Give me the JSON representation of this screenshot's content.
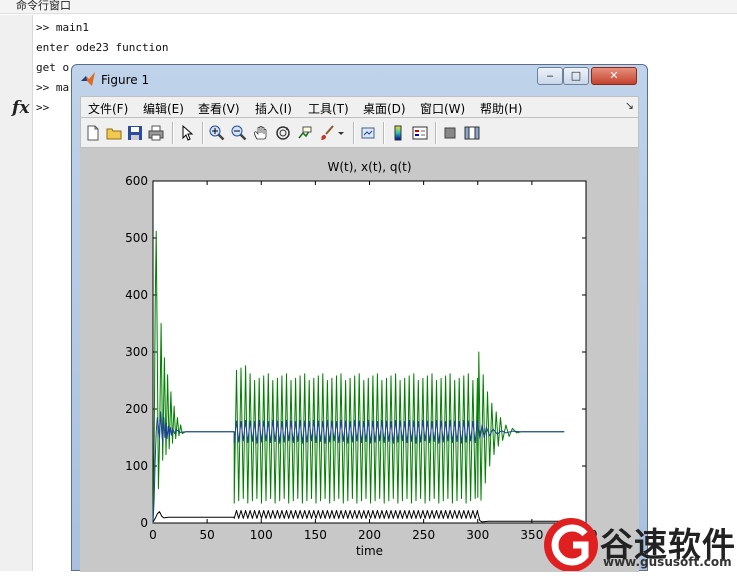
{
  "command_window": {
    "title": "命令行窗口",
    "lines": [
      ">> main1",
      "enter ode23 function",
      "get o",
      ">> ma",
      ">>"
    ],
    "fx_label": "fx"
  },
  "figure": {
    "title": "Figure 1",
    "menu": [
      "文件(F)",
      "编辑(E)",
      "查看(V)",
      "插入(I)",
      "工具(T)",
      "桌面(D)",
      "窗口(W)",
      "帮助(H)"
    ],
    "toolbar_icons": [
      "new-figure-icon",
      "open-file-icon",
      "save-icon",
      "print-icon",
      "pointer-icon",
      "zoom-in-icon",
      "zoom-out-icon",
      "pan-hand-icon",
      "rotate-3d-icon",
      "data-cursor-icon",
      "brush-icon",
      "link-plot-icon",
      "colorbar-icon",
      "legend-icon",
      "hide-plot-tools-icon",
      "show-plot-tools-icon"
    ]
  },
  "chart_data": {
    "type": "line",
    "title": "W(t), x(t), q(t)",
    "xlabel": "time",
    "ylabel": "",
    "xlim": [
      0,
      400
    ],
    "ylim": [
      0,
      600
    ],
    "xticks": [
      0,
      50,
      100,
      150,
      200,
      250,
      300,
      350,
      400
    ],
    "xtick_labels": [
      "0",
      "50",
      "100",
      "150",
      "200",
      "250",
      "300",
      "350",
      "400"
    ],
    "yticks": [
      0,
      100,
      200,
      300,
      400,
      500,
      600
    ],
    "ytick_labels": [
      "0",
      "100",
      "200",
      "300",
      "400",
      "500",
      "600"
    ],
    "grid": false,
    "series": [
      {
        "color": "#007f00",
        "description": "green oscillating series: spike to ~512 near t=3, damped to 160 by t~25, flat 160 to t=75, oscillation between ~40 and ~260 from t=75 to t=300, spike ~300 at t=300, damped back to 160 by t~340, flat to t=380",
        "points": [
          [
            0,
            0
          ],
          [
            3,
            512
          ],
          [
            5,
            60
          ],
          [
            8,
            350
          ],
          [
            10,
            100
          ],
          [
            13,
            260
          ],
          [
            16,
            130
          ],
          [
            20,
            200
          ],
          [
            25,
            160
          ],
          [
            75,
            160
          ],
          [
            75,
            30
          ],
          [
            300,
            40
          ],
          [
            300,
            300
          ],
          [
            310,
            120
          ],
          [
            320,
            200
          ],
          [
            330,
            150
          ],
          [
            340,
            160
          ],
          [
            380,
            160
          ]
        ]
      },
      {
        "color": "#1f3f99",
        "description": "blue series near 160: peak ~195 at t~7, oscillates 140-180 from t=75 to t=300",
        "points": [
          [
            0,
            0
          ],
          [
            7,
            195
          ],
          [
            15,
            150
          ],
          [
            25,
            160
          ],
          [
            75,
            160
          ],
          [
            75,
            140
          ],
          [
            300,
            180
          ],
          [
            320,
            160
          ],
          [
            380,
            160
          ]
        ]
      },
      {
        "color": "#000000",
        "description": "black series near bottom: ~10, oscillates 5-25 between t=75 and t=300",
        "points": [
          [
            0,
            5
          ],
          [
            5,
            18
          ],
          [
            10,
            10
          ],
          [
            75,
            10
          ],
          [
            75,
            25
          ],
          [
            300,
            20
          ],
          [
            305,
            5
          ],
          [
            380,
            5
          ]
        ]
      }
    ]
  },
  "watermark": {
    "text": "谷速软件",
    "url": "www.gususoft.com"
  }
}
